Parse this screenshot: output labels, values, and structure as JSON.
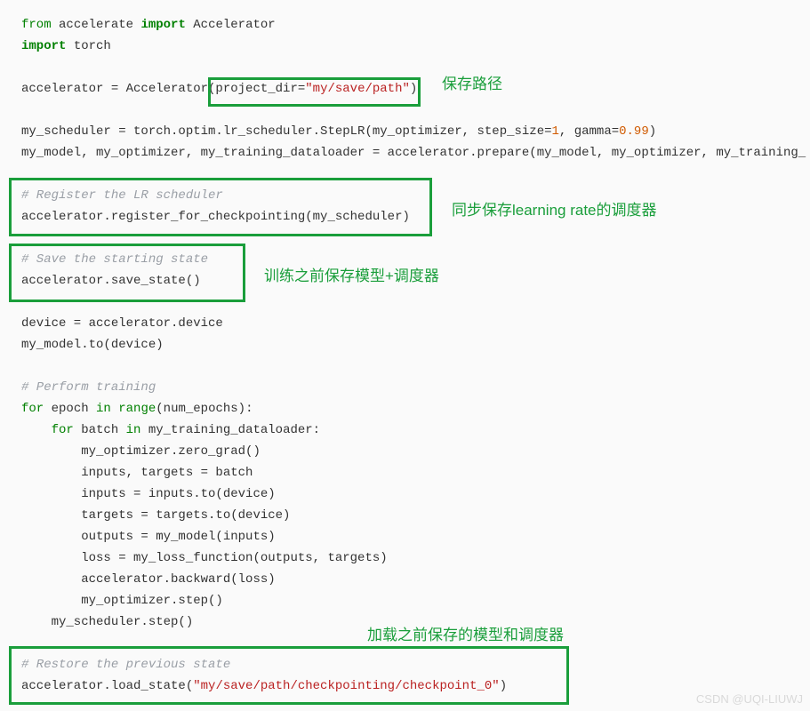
{
  "code": {
    "l1a": "from",
    "l1b": " accelerate ",
    "l1c": "import",
    "l1d": " Accelerator",
    "l2a": "import",
    "l2b": " torch",
    "l4": "accelerator = Accelerator(project_dir=",
    "l4s": "\"my/save/path\"",
    "l4e": ")",
    "l6": "my_scheduler = torch.optim.lr_scheduler.StepLR(my_optimizer, step_size=",
    "l6n1": "1",
    "l6m": ", gamma=",
    "l6n2": "0.99",
    "l6e": ")",
    "l7": "my_model, my_optimizer, my_training_dataloader = accelerator.prepare(my_model, my_optimizer, my_training_",
    "l9": "# Register the LR scheduler",
    "l10": "accelerator.register_for_checkpointing(my_scheduler)",
    "l12": "# Save the starting state",
    "l13": "accelerator.save_state()",
    "l15": "device = accelerator.device",
    "l16": "my_model.to(device)",
    "l18": "# Perform training",
    "l19a": "for",
    "l19b": " epoch ",
    "l19c": "in",
    "l19d": " ",
    "l19e": "range",
    "l19f": "(num_epochs):",
    "l20a": "    ",
    "l20b": "for",
    "l20c": " batch ",
    "l20d": "in",
    "l20e": " my_training_dataloader:",
    "l21": "        my_optimizer.zero_grad()",
    "l22": "        inputs, targets = batch",
    "l23": "        inputs = inputs.to(device)",
    "l24": "        targets = targets.to(device)",
    "l25": "        outputs = my_model(inputs)",
    "l26": "        loss = my_loss_function(outputs, targets)",
    "l27": "        accelerator.backward(loss)",
    "l28": "        my_optimizer.step()",
    "l29": "    my_scheduler.step()",
    "l31": "# Restore the previous state",
    "l32a": "accelerator.load_state(",
    "l32s": "\"my/save/path/checkpointing/checkpoint_0\"",
    "l32e": ")"
  },
  "annotations": {
    "a1": "保存路径",
    "a2": "同步保存learning rate的调度器",
    "a3": "训练之前保存模型+调度器",
    "a4": "加载之前保存的模型和调度器"
  },
  "watermark": "CSDN @UQI-LIUWJ"
}
